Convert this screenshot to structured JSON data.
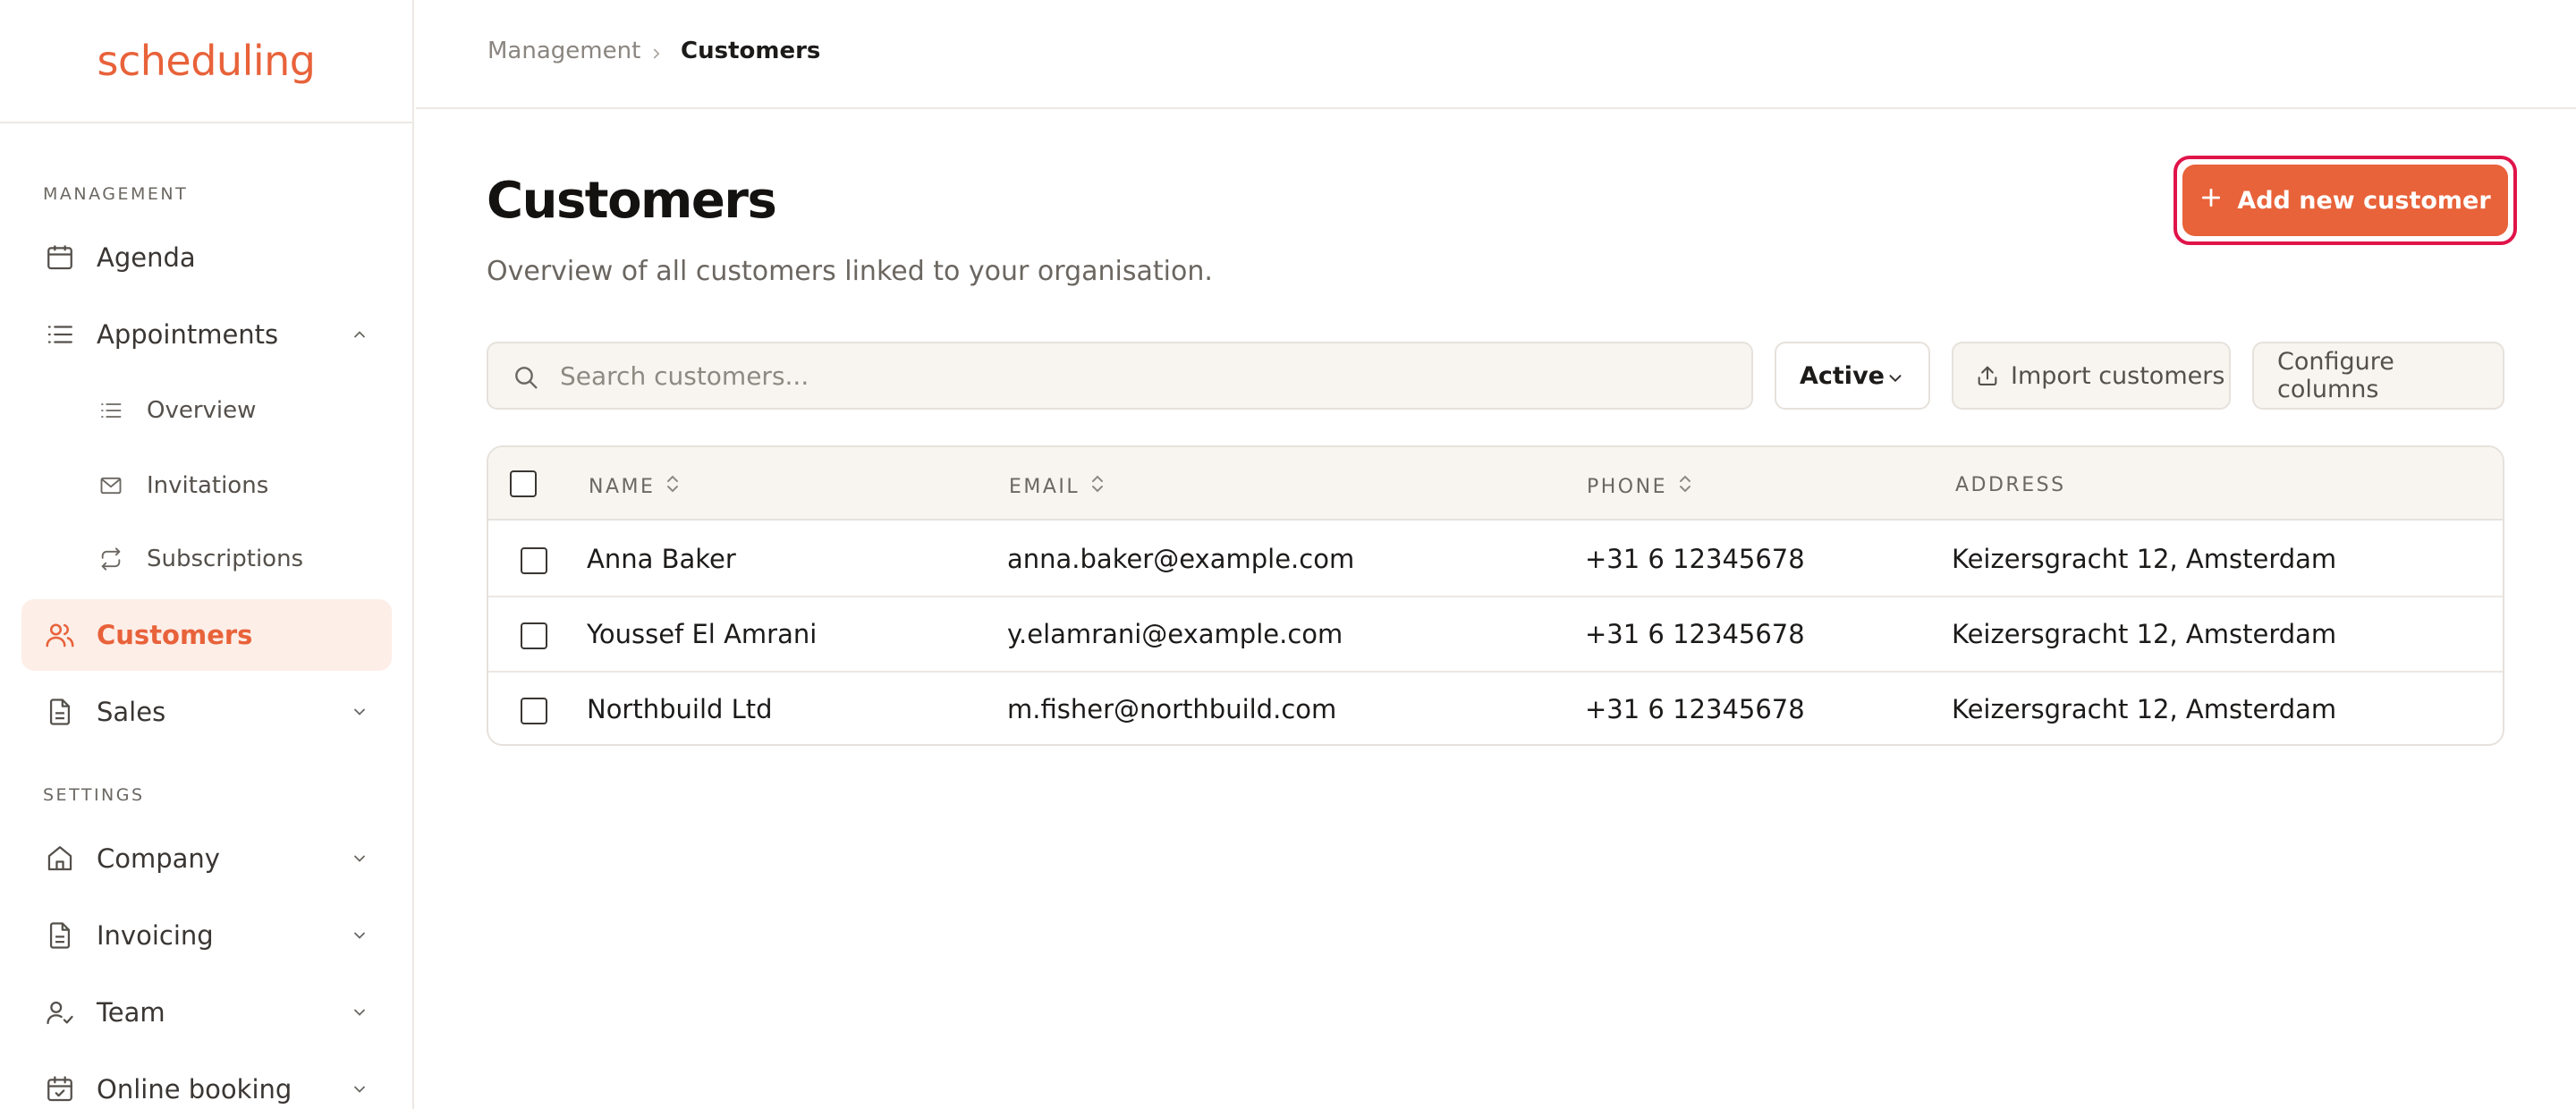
{
  "app": {
    "logo": "scheduling"
  },
  "sidebar": {
    "sections": {
      "management": "MANAGEMENT",
      "settings": "SETTINGS"
    },
    "items": {
      "agenda": "Agenda",
      "appointments": "Appointments",
      "overview": "Overview",
      "invitations": "Invitations",
      "subscriptions": "Subscriptions",
      "customers": "Customers",
      "sales": "Sales",
      "company": "Company",
      "invoicing": "Invoicing",
      "team": "Team",
      "online_booking": "Online booking"
    }
  },
  "breadcrumb": {
    "parent": "Management",
    "current": "Customers"
  },
  "page": {
    "title": "Customers",
    "subtitle": "Overview of all customers linked to your organisation.",
    "add_button": "Add new customer"
  },
  "toolbar": {
    "search_placeholder": "Search customers...",
    "status_filter": "Active",
    "import_label": "Import customers",
    "configure_label": "Configure columns"
  },
  "table": {
    "columns": {
      "name": "NAME",
      "email": "EMAIL",
      "phone": "PHONE",
      "address": "ADDRESS"
    },
    "rows": [
      {
        "name": "Anna Baker",
        "email": "anna.baker@example.com",
        "phone": "+31 6 12345678",
        "address": "Keizersgracht 12, Amsterdam"
      },
      {
        "name": "Youssef El Amrani",
        "email": "y.elamrani@example.com",
        "phone": "+31 6 12345678",
        "address": "Keizersgracht 12, Amsterdam"
      },
      {
        "name": "Northbuild Ltd",
        "email": "m.fisher@northbuild.com",
        "phone": "+31 6 12345678",
        "address": "Keizersgracht 12, Amsterdam"
      }
    ]
  },
  "colors": {
    "accent": "#e8623a",
    "accent_soft": "#fdeee8",
    "focus_ring": "#e0144a"
  }
}
